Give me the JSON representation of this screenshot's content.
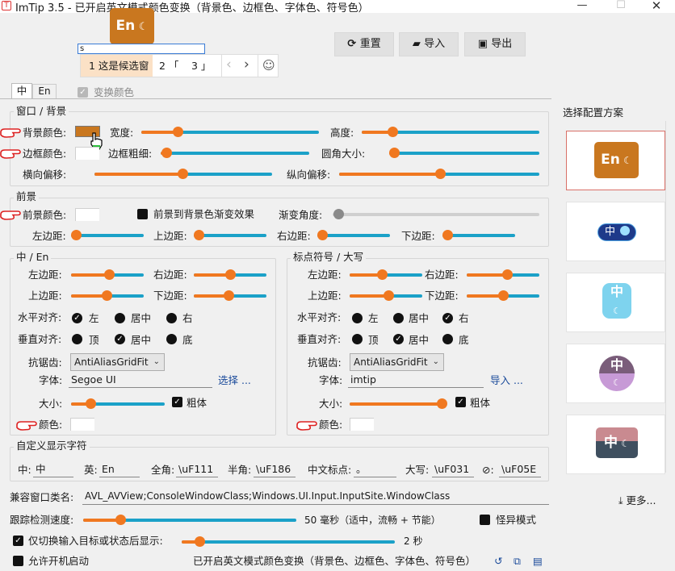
{
  "window": {
    "title": "ImTip 3.5 - 已开启英文模式颜色变换（背景色、边框色、字体色、符号色）"
  },
  "toolbar": {
    "reset": "重置",
    "import": "导入",
    "export": "导出"
  },
  "candidate": {
    "input": "s",
    "first": "1 这是候选窗",
    "item2": "2 「",
    "item3": "3 」",
    "prev": "‹",
    "next": "›",
    "emoji": "☺"
  },
  "badge": {
    "text": "En"
  },
  "tabs": {
    "zh": "中",
    "en": "En",
    "swap": "变换颜色"
  },
  "window_bg": {
    "title": "窗口 / 背景",
    "bg_color": "背景颜色:",
    "width": "宽度:",
    "height": "高度:",
    "border_color": "边框颜色:",
    "border_width": "边框粗细:",
    "corner": "圆角大小:",
    "offset_x": "横向偏移:",
    "offset_y": "纵向偏移:",
    "bg_color_value": "#c9771f"
  },
  "fore": {
    "title": "前景",
    "color": "前景颜色:",
    "gradient": "前景到背景色渐变效果",
    "angle": "渐变角度:",
    "left": "左边距:",
    "top": "上边距:",
    "right": "右边距:",
    "bottom": "下边距:"
  },
  "zh_en": {
    "title": "中 / En",
    "left": "左边距:",
    "right": "右边距:",
    "top": "上边距:",
    "bottom": "下边距:",
    "halign": "水平对齐:",
    "valign": "垂直对齐:",
    "h_opts": [
      "左",
      "居中",
      "右"
    ],
    "v_opts": [
      "顶",
      "居中",
      "底"
    ],
    "aa": "抗锯齿:",
    "aa_value": "AntiAliasGridFit",
    "font": "字体:",
    "font_value": "Segoe UI",
    "choose": "选择 ...",
    "size": "大小:",
    "bold": "粗体",
    "color": "颜色:"
  },
  "punct": {
    "title": "标点符号 / 大写",
    "left": "左边距:",
    "right": "右边距:",
    "top": "上边距:",
    "bottom": "下边距:",
    "halign": "水平对齐:",
    "valign": "垂直对齐:",
    "h_opts": [
      "左",
      "居中",
      "右"
    ],
    "v_opts": [
      "顶",
      "居中",
      "底"
    ],
    "aa": "抗锯齿:",
    "aa_value": "AntiAliasGridFit",
    "font": "字体:",
    "font_value": "imtip",
    "import": "导入 ...",
    "size": "大小:",
    "bold": "粗体",
    "color": "颜色:"
  },
  "custom": {
    "title": "自定义显示字符",
    "zh_label": "中:",
    "zh_value": "中",
    "en_label": "英:",
    "en_value": "En",
    "full_label": "全角:",
    "full_value": "\\uF111",
    "half_label": "半角:",
    "half_value": "\\uF186",
    "punct_label": "中文标点:",
    "punct_value": "。",
    "caps_label": "大写:",
    "caps_value": "\\uF031",
    "sym_label": "⊘:",
    "sym_value": "\\uF05E"
  },
  "bottom": {
    "compat_label": "兼容窗口类名:",
    "compat_value": "AVL_AVView;ConsoleWindowClass;Windows.UI.Input.InputSite.WindowClass",
    "more": "更多...",
    "track_label": "跟踪检测速度:",
    "track_value": "50 毫秒（适中，流畅 + 节能）",
    "weird": "怪异模式",
    "only_switch": "仅切换输入目标或状态后显示:",
    "only_value": "2 秒",
    "autostart": "允许开机启动",
    "status": "已开启英文模式颜色变换（背景色、边框色、字体色、符号色）"
  },
  "presets": {
    "title": "选择配置方案",
    "p1": "En",
    "p2": "中",
    "p3": "中",
    "p4": "中",
    "p5": "中"
  }
}
